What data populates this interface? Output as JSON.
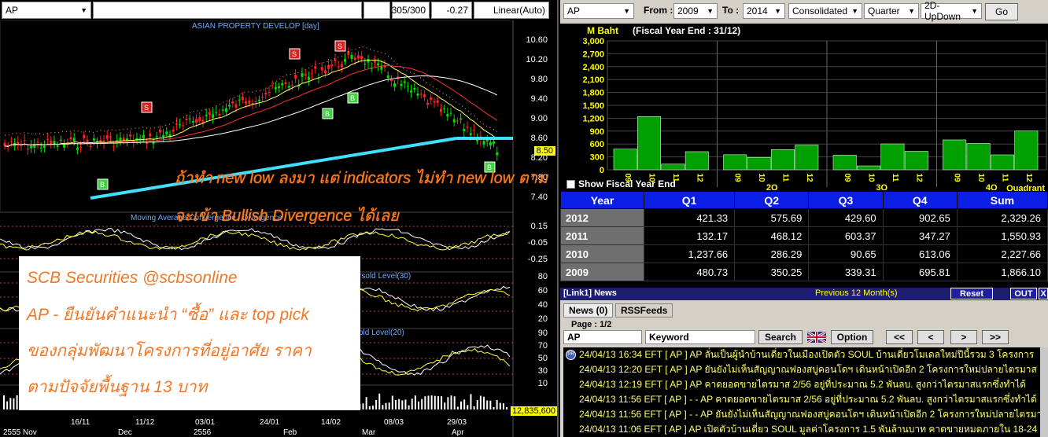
{
  "chart_pane": {
    "symbol": "AP",
    "count": "305/300",
    "change": "-0.27",
    "scale_mode": "Linear(Auto)",
    "title": "ASIAN PROPERTY DEVELOP [day]",
    "price_ticks": [
      "10.60",
      "10.20",
      "9.80",
      "9.40",
      "9.00",
      "8.60",
      "8.20",
      "7.80",
      "7.40"
    ],
    "price_tag": "8.50",
    "macd_title": "Moving Average Convergence / Divergence",
    "macd_ticks": [
      "0.15",
      "-0.05",
      "-0.25"
    ],
    "rsi_title": "rsold Level(30)",
    "rsi_ticks": [
      "80",
      "60",
      "40",
      "20"
    ],
    "stoch_title": "old Level(20)",
    "stoch_ticks": [
      "90",
      "70",
      "50",
      "30",
      "10"
    ],
    "volume_tag": "12,835,600",
    "x_ticks": [
      "16/11",
      "11/12",
      "03/01",
      "24/01",
      "14/02",
      "08/03",
      "29/03"
    ],
    "x_months": [
      "2555 Nov",
      "Dec",
      "2556",
      "Feb",
      "Mar",
      "Apr"
    ],
    "signal_markers": [
      "S",
      "S",
      "S",
      "B",
      "B",
      "B",
      "B"
    ],
    "overlay_line1": "ถ้าทำ new low ลงมา แต่ indicators ไม่ทำ new low ตาม",
    "overlay_line2": "จะเข้า Bullish Divergence ได้เลย",
    "scb_lines": [
      "SCB Securities @scbsonline",
      "AP - ยืนยันคำแนะนำ “ซื้อ” และ top pick",
      "ของกลุ่มพัฒนาโครงการที่อยู่อาศัย ราคา",
      "ตามปัจจัยพื้นฐาน 13 บาท"
    ]
  },
  "financial_pane": {
    "symbol": "AP",
    "from_label": "From :",
    "from_year": "2009",
    "to_label": "To :",
    "to_year": "2014",
    "view": "Consolidated",
    "period": "Quarter",
    "chart_mode": "2D-UpDown",
    "go_label": "Go",
    "unit": "M Baht",
    "fiscal_year_end": "(Fiscal Year End : 31/12)",
    "show_fiscal_label": "Show Fiscal Year End",
    "quadrant_label": "Quadrant",
    "colors": {
      "bar": "#00a000",
      "header_blue": "#0a1ee6",
      "tick_yellow": "#ffff00"
    }
  },
  "chart_data": {
    "type": "bar",
    "title": "",
    "ylabel": "M Baht",
    "ylim": [
      0,
      3000
    ],
    "yticks": [
      "3,000",
      "2,700",
      "2,400",
      "2,100",
      "1,800",
      "1,500",
      "1,200",
      "900",
      "600",
      "300",
      "0"
    ],
    "groups": [
      "2Q",
      "3Q",
      "4Q"
    ],
    "group_labels": [
      "",
      "2Q",
      "3Q",
      "4Q"
    ],
    "categories": [
      "09",
      "10",
      "11",
      "12"
    ],
    "series": [
      {
        "values": [
          480.73,
          1237.66,
          132.17,
          421.33
        ]
      },
      {
        "values": [
          350.25,
          286.29,
          468.12,
          575.69
        ]
      },
      {
        "values": [
          339.31,
          90.65,
          603.37,
          429.6
        ]
      },
      {
        "values": [
          695.81,
          613.06,
          347.27,
          902.65
        ]
      }
    ],
    "grid": true
  },
  "table": {
    "headers": [
      "Year",
      "Q1",
      "Q2",
      "Q3",
      "Q4",
      "Sum"
    ],
    "rows": [
      [
        "2012",
        "421.33",
        "575.69",
        "429.60",
        "902.65",
        "2,329.26"
      ],
      [
        "2011",
        "132.17",
        "468.12",
        "603.37",
        "347.27",
        "1,550.93"
      ],
      [
        "2010",
        "1,237.66",
        "286.29",
        "90.65",
        "613.06",
        "2,227.66"
      ],
      [
        "2009",
        "480.73",
        "350.25",
        "339.31",
        "695.81",
        "1,866.10"
      ]
    ]
  },
  "news": {
    "title": "[Link1] News",
    "period": "Previous 12 Month(s)",
    "reset_label": "Reset",
    "out_label": "OUT",
    "close_label": "X",
    "tab_news": "News (0)",
    "tab_rss": "RSSFeeds",
    "page": "Page : 1/2",
    "symbol_value": "AP",
    "keyword_value": "Keyword",
    "search_label": "Search",
    "option_label": "Option",
    "nav": [
      "<<",
      "<",
      ">",
      ">>"
    ],
    "items": [
      "24/04/13 16:34  EFT  [ AP ]  AP ลั่นเป็นผู้นำบ้านเดี่ยวในเมืองเปิดตัว SOUL บ้านเดี่ยวโมเดลใหม่ปีนี้รวม 3 โครงการ",
      "24/04/13 12:20  EFT  [ AP ]  AP ยันยังไม่เห็นสัญญาณฟองสบู่คอนโดฯ เดินหน้าเปิดอีก 2 โครงการใหม่ปลายไตรมาส",
      "24/04/13 12:19  EFT  [ AP ]  AP คาดยอดขายไตรมาส 2/56 อยู่ที่ประมาณ 5.2 พันลบ. สูงกว่าไตรมาสแรกซึ่งทำได้",
      "24/04/13 11:56  EFT  [ AP ]  - - AP คาดยอดขายไตรมาส 2/56 อยู่ที่ประมาณ 5.2 พันลบ. สูงกว่าไตรมาสแรกซึ่งทำได้",
      "24/04/13 11:56  EFT  [ AP ]  - - AP ยันยังไม่เห็นสัญญาณฟองสบู่คอนโดฯ เดินหน้าเปิดอีก 2 โครงการใหม่ปลายไตรมาส",
      "24/04/13 11:06  EFT  [ AP ]  AP เปิดตัวบ้านเดี่ยว SOUL มูลค่าโครงการ 1.5 พันล้านบาท คาดขายหมดภายใน 18-24"
    ]
  }
}
